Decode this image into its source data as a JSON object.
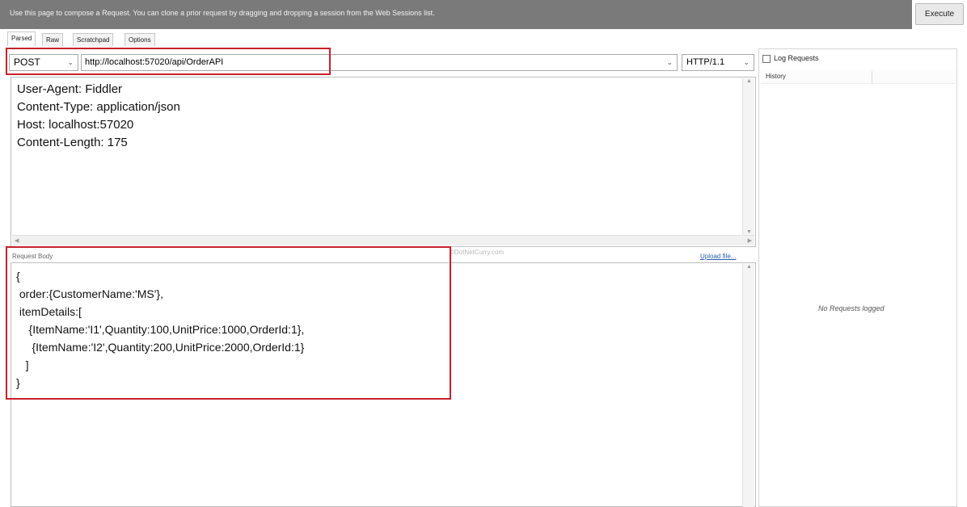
{
  "info_bar": {
    "message": "Use this page to compose a Request. You can clone a prior request by dragging and dropping a session from the Web Sessions list.",
    "execute_label": "Execute"
  },
  "tabs": [
    {
      "label": "Parsed",
      "active": true
    },
    {
      "label": "Raw",
      "active": false
    },
    {
      "label": "Scratchpad",
      "active": false
    },
    {
      "label": "Options",
      "active": false
    }
  ],
  "request_line": {
    "method": "POST",
    "url": "http://localhost:57020/api/OrderAPI",
    "protocol": "HTTP/1.1"
  },
  "headers_text": "User-Agent: Fiddler\nContent-Type: application/json\nHost: localhost:57020\nContent-Length: 175",
  "request_body": {
    "label": "Request Body",
    "upload_label": "Upload file...",
    "watermark": "©DotNetCurry.com",
    "text": "{\n order:{CustomerName:'MS'},\n itemDetails:[\n    {ItemName:'I1',Quantity:100,UnitPrice:1000,OrderId:1},\n     {ItemName:'I2',Quantity:200,UnitPrice:2000,OrderId:1}\n   ]\n}"
  },
  "right_panel": {
    "log_requests_label": "Log Requests",
    "log_requests_checked": false,
    "history_label": "History",
    "empty_message": "No Requests logged"
  },
  "colors": {
    "info_bar_bg": "#7a7a7a",
    "highlight": "#c8202c",
    "link": "#2a5db0"
  }
}
